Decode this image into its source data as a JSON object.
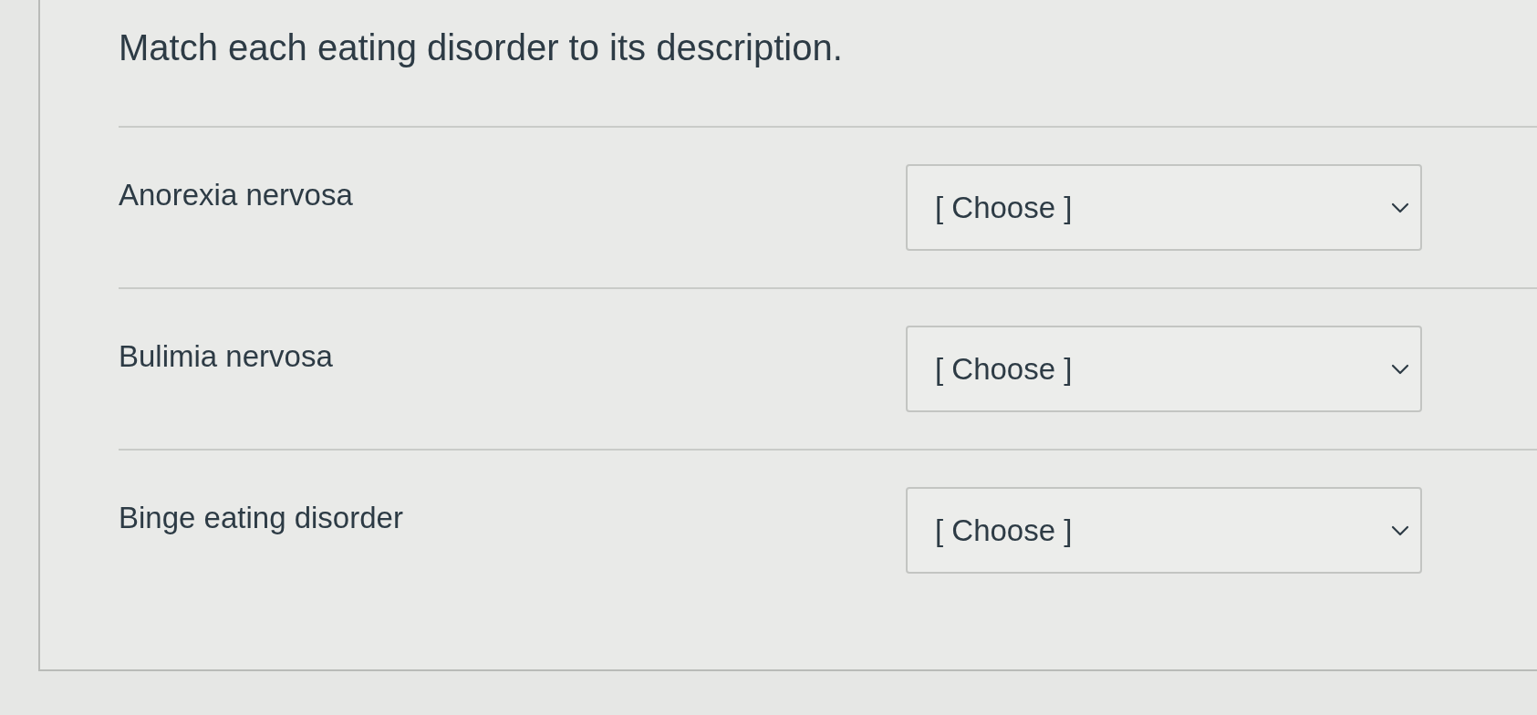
{
  "question": "Match each eating disorder to its description.",
  "rows": [
    {
      "term": "Anorexia nervosa",
      "choice": "[ Choose ]"
    },
    {
      "term": "Bulimia nervosa",
      "choice": "[ Choose ]"
    },
    {
      "term": "Binge eating disorder",
      "choice": "[ Choose ]"
    }
  ]
}
